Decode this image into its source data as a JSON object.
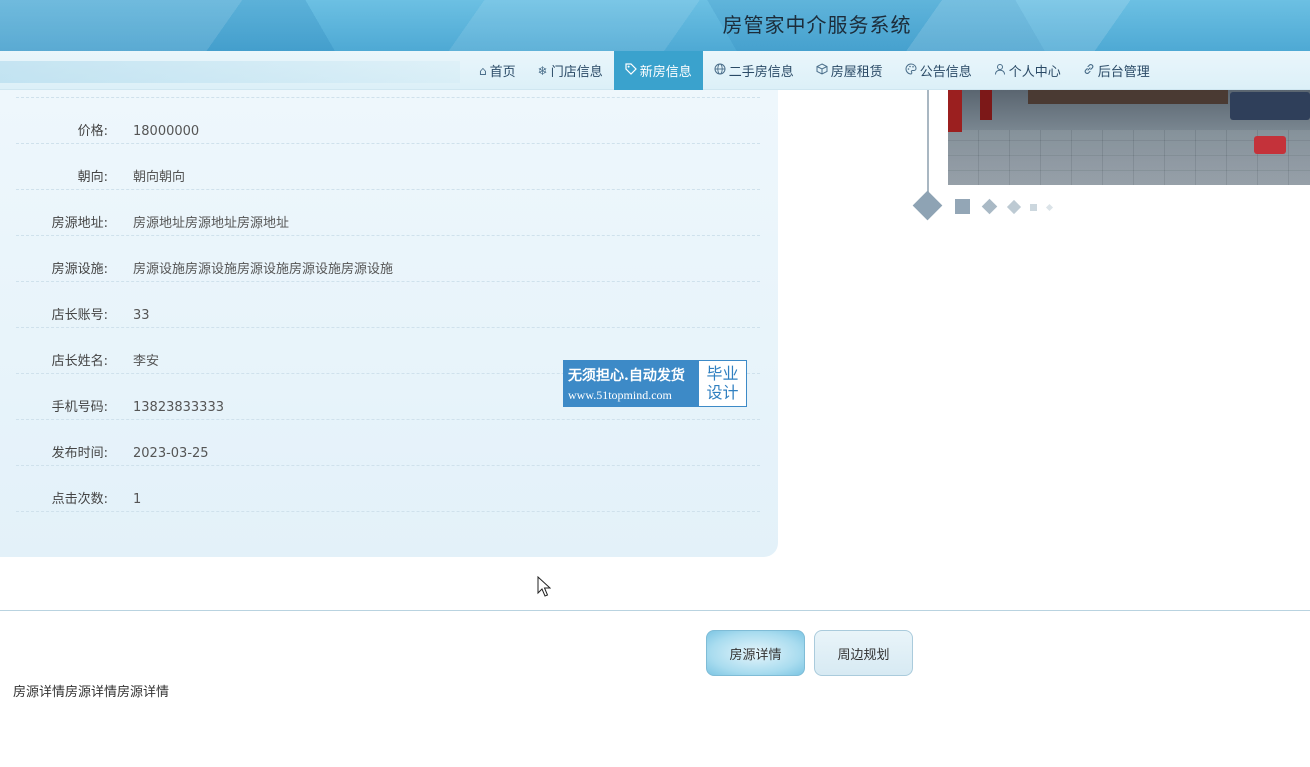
{
  "header": {
    "site_title": "房管家中介服务系统"
  },
  "nav": {
    "items": [
      {
        "label": "首页",
        "icon": "home-icon",
        "glyph": "⌂",
        "active": false
      },
      {
        "label": "门店信息",
        "icon": "snowflake-icon",
        "glyph": "❄",
        "active": false
      },
      {
        "label": "新房信息",
        "icon": "tag-icon",
        "glyph": "🏷",
        "active": true
      },
      {
        "label": "二手房信息",
        "icon": "globe-icon",
        "glyph": "◎",
        "active": false
      },
      {
        "label": "房屋租赁",
        "icon": "cube-icon",
        "glyph": "⬡",
        "active": false
      },
      {
        "label": "公告信息",
        "icon": "palette-icon",
        "glyph": "◔",
        "active": false
      },
      {
        "label": "个人中心",
        "icon": "user-icon",
        "glyph": "♙",
        "active": false
      },
      {
        "label": "后台管理",
        "icon": "link-icon",
        "glyph": "🔗",
        "active": false
      }
    ]
  },
  "detail": {
    "rows": [
      {
        "label": "价格:",
        "value": "18000000"
      },
      {
        "label": "朝向:",
        "value": "朝向朝向"
      },
      {
        "label": "房源地址:",
        "value": "房源地址房源地址房源地址"
      },
      {
        "label": "房源设施:",
        "value": "房源设施房源设施房源设施房源设施房源设施"
      },
      {
        "label": "店长账号:",
        "value": "33"
      },
      {
        "label": "店长姓名:",
        "value": "李安"
      },
      {
        "label": "手机号码:",
        "value": "13823833333"
      },
      {
        "label": "发布时间:",
        "value": "2023-03-25"
      },
      {
        "label": "点击次数:",
        "value": "1"
      }
    ]
  },
  "watermark": {
    "line1": "无须担心.自动发货",
    "line2": "www.51topmind.com",
    "badge_top": "毕业",
    "badge_bottom": "设计"
  },
  "tabs": {
    "detail_label": "房源详情",
    "plan_label": "周边规划",
    "active": "detail",
    "content": "房源详情房源详情房源详情"
  },
  "colors": {
    "nav_active": "#3aa2cd",
    "header": "#4ea9d4",
    "card": "#e3f1f9",
    "watermark": "#3d8ac7"
  }
}
